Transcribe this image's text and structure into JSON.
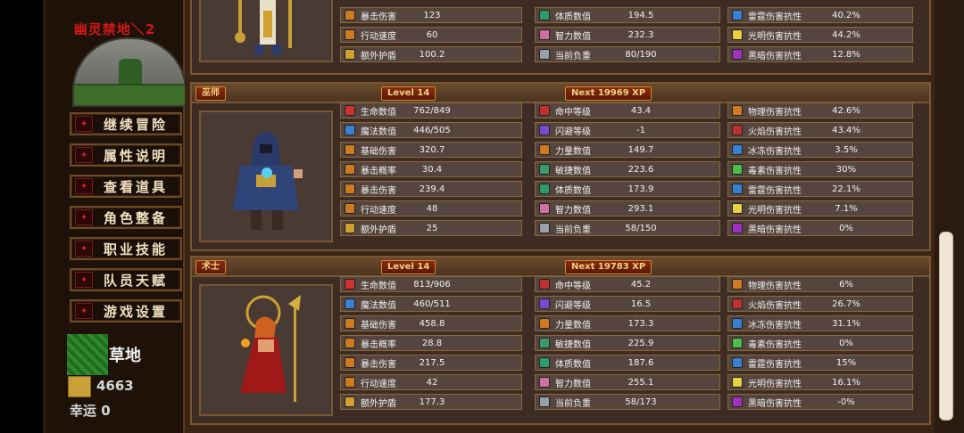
{
  "sidebar": {
    "location": "幽灵禁地＼2",
    "menu": [
      {
        "label": "继续冒险",
        "icon": "adventure-icon"
      },
      {
        "label": "属性说明",
        "icon": "attributes-icon"
      },
      {
        "label": "查看道具",
        "icon": "items-icon"
      },
      {
        "label": "角色整备",
        "icon": "equip-icon"
      },
      {
        "label": "职业技能",
        "icon": "skills-icon"
      },
      {
        "label": "队员天赋",
        "icon": "talent-icon"
      },
      {
        "label": "游戏设置",
        "icon": "settings-icon"
      }
    ],
    "terrain": "草地",
    "gold": "4663",
    "luck": "幸运 0"
  },
  "icons": {
    "health": "#d03030",
    "mana": "#3a80d0",
    "damage": "#d07a20",
    "dodge": "#7a4ad0",
    "poison": "#4ac04a",
    "dark": "#a030c0",
    "light": "#e8d040"
  },
  "characters": [
    {
      "partial": true,
      "stats": [
        [
          "暴击伤害",
          "123",
          "体质数值",
          "194.5",
          "雷霆伤害抗性",
          "40.2%"
        ],
        [
          "行动速度",
          "60",
          "智力数值",
          "232.3",
          "光明伤害抗性",
          "44.2%"
        ],
        [
          "额外护盾",
          "100.2",
          "当前负重",
          "80/190",
          "黑暗伤害抗性",
          "12.8%"
        ]
      ]
    },
    {
      "class": "巫师",
      "level": "Level 14",
      "next": "Next 19969 XP",
      "stats": [
        [
          "生命数值",
          "762/849",
          "命中等级",
          "43.4",
          "物理伤害抗性",
          "42.6%"
        ],
        [
          "魔法数值",
          "446/505",
          "闪避等级",
          "-1",
          "火焰伤害抗性",
          "43.4%"
        ],
        [
          "基础伤害",
          "320.7",
          "力量数值",
          "149.7",
          "冰冻伤害抗性",
          "3.5%"
        ],
        [
          "暴击概率",
          "30.4",
          "敏捷数值",
          "223.6",
          "毒素伤害抗性",
          "30%"
        ],
        [
          "暴击伤害",
          "239.4",
          "体质数值",
          "173.9",
          "雷霆伤害抗性",
          "22.1%"
        ],
        [
          "行动速度",
          "48",
          "智力数值",
          "293.1",
          "光明伤害抗性",
          "7.1%"
        ],
        [
          "额外护盾",
          "25",
          "当前负重",
          "58/150",
          "黑暗伤害抗性",
          "0%"
        ]
      ]
    },
    {
      "class": "术士",
      "level": "Level 14",
      "next": "Next 19783 XP",
      "stats": [
        [
          "生命数值",
          "813/906",
          "命中等级",
          "45.2",
          "物理伤害抗性",
          "6%"
        ],
        [
          "魔法数值",
          "460/511",
          "闪避等级",
          "16.5",
          "火焰伤害抗性",
          "26.7%"
        ],
        [
          "基础伤害",
          "458.8",
          "力量数值",
          "173.3",
          "冰冻伤害抗性",
          "31.1%"
        ],
        [
          "暴击概率",
          "28.8",
          "敏捷数值",
          "225.9",
          "毒素伤害抗性",
          "0%"
        ],
        [
          "暴击伤害",
          "217.5",
          "体质数值",
          "187.6",
          "雷霆伤害抗性",
          "15%"
        ],
        [
          "行动速度",
          "42",
          "智力数值",
          "255.1",
          "光明伤害抗性",
          "16.1%"
        ],
        [
          "额外护盾",
          "177.3",
          "当前负重",
          "58/173",
          "黑暗伤害抗性",
          "-0%"
        ]
      ]
    }
  ]
}
